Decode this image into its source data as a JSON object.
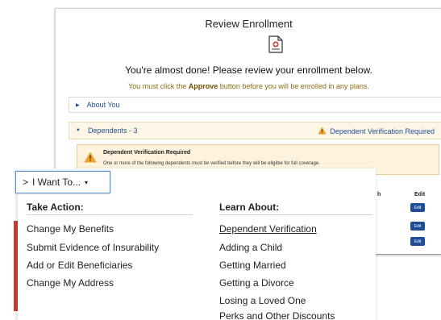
{
  "review": {
    "title": "Review Enrollment",
    "subtitle": "You're almost done! Please review your enrollment below.",
    "note_before": "You must click the ",
    "note_bold": "Approve",
    "note_after": " button before you will be enrolled in any plans.",
    "sections": {
      "about": "About You",
      "dependents": "Dependents - 3",
      "dependents_warning": "Dependent Verification Required"
    },
    "verification": {
      "title": "Dependent Verification Required",
      "text": "One or more of the following dependents must be verified before they will be eligible for full coverage."
    },
    "table": {
      "col_partial": "h",
      "col_edit": "Edit",
      "edit_label": "Edit"
    }
  },
  "menu": {
    "trigger_chevron": ">",
    "trigger_label": "I Want To...",
    "trigger_caret": "▾",
    "take_action": {
      "heading": "Take Action:",
      "items": [
        "Change My Benefits",
        "Submit Evidence of Insurability",
        "Add or Edit Beneficiaries",
        "Change My Address"
      ]
    },
    "learn_about": {
      "heading": "Learn About:",
      "items": [
        "Dependent Verification",
        "Adding a Child",
        "Getting Married",
        "Getting a Divorce",
        "Losing a Loved One",
        "Perks and Other Discounts"
      ]
    }
  },
  "colors": {
    "link_blue": "#1f4e98",
    "warning_bg": "#fdf3dc",
    "warning_icon": "#f0a020",
    "accent_red": "#d23a32"
  }
}
